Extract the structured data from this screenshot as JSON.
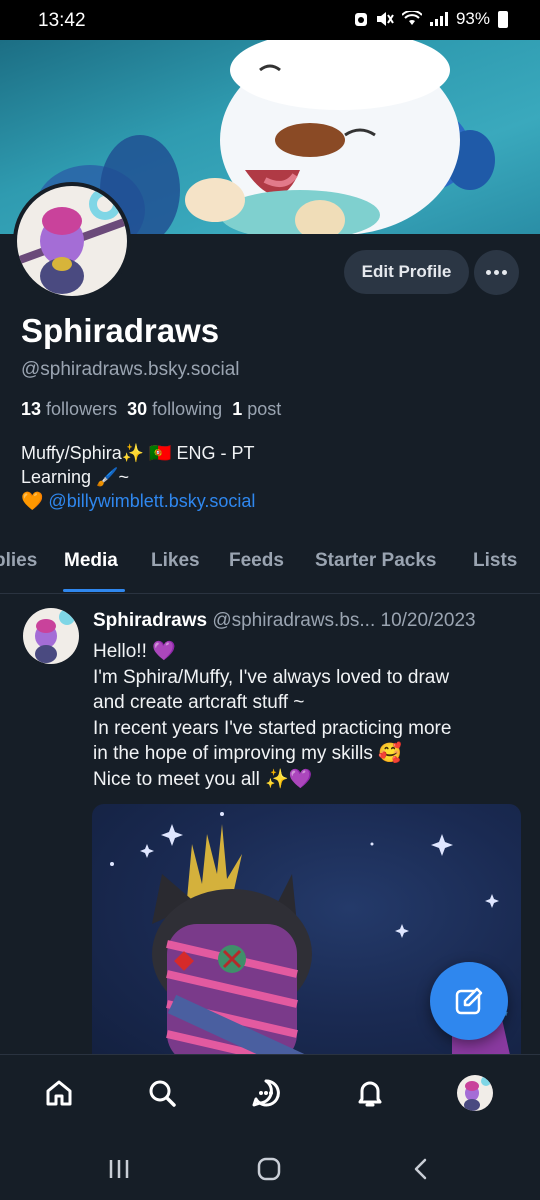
{
  "status": {
    "time": "13:42",
    "battery": "93%",
    "icons": [
      "data-saver-icon",
      "mute-icon",
      "wifi-icon",
      "signal-icon",
      "battery-icon"
    ]
  },
  "profile": {
    "display_name": "Sphiradraws",
    "handle": "@sphiradraws.bsky.social",
    "followers_count": "13",
    "followers_label": "followers",
    "following_count": "30",
    "following_label": "following",
    "posts_count": "1",
    "posts_label": "post",
    "edit_button": "Edit Profile",
    "bio_line1": "Muffy/Sphira✨ 🇵🇹 ENG - PT",
    "bio_line2": "Learning 🖌️~",
    "bio_line3_prefix": "🧡 ",
    "bio_link": "@billywimblett.bsky.social"
  },
  "tabs": [
    {
      "label": "plies"
    },
    {
      "label": "Media",
      "active": true
    },
    {
      "label": "Likes"
    },
    {
      "label": "Feeds"
    },
    {
      "label": "Starter Packs"
    },
    {
      "label": "Lists"
    }
  ],
  "post": {
    "author": "Sphiradraws",
    "handle": "@sphiradraws.bs...",
    "date": "10/20/2023",
    "lines": [
      "Hello!! 💜",
      "I'm Sphira/Muffy, I've always loved to draw",
      "and create artcraft stuff ~",
      "In recent years I've started practicing more",
      "in the hope of improving my skills 🥰",
      "Nice to meet you all ✨💜"
    ]
  },
  "colors": {
    "background": "#161e27",
    "accent": "#2f87ee",
    "muted_text": "#9aa4b1",
    "button_bg": "#2b3644"
  },
  "nav": [
    "home-icon",
    "search-icon",
    "chat-icon",
    "notifications-icon",
    "profile-avatar"
  ]
}
